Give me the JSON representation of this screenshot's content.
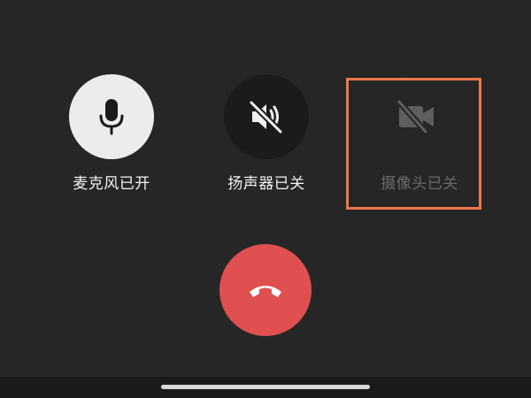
{
  "call_controls": {
    "microphone": {
      "label": "麦克风已开",
      "state": "on",
      "icon": "microphone-icon"
    },
    "speaker": {
      "label": "扬声器已关",
      "state": "off",
      "icon": "speaker-muted-icon"
    },
    "camera": {
      "label": "摄像头已关",
      "state": "off",
      "icon": "camera-off-icon"
    }
  },
  "end_call": {
    "icon": "phone-hangup-icon"
  },
  "colors": {
    "background": "#262626",
    "end_call": "#e05050",
    "highlight": "#f0784a",
    "active_button": "#ececec"
  }
}
